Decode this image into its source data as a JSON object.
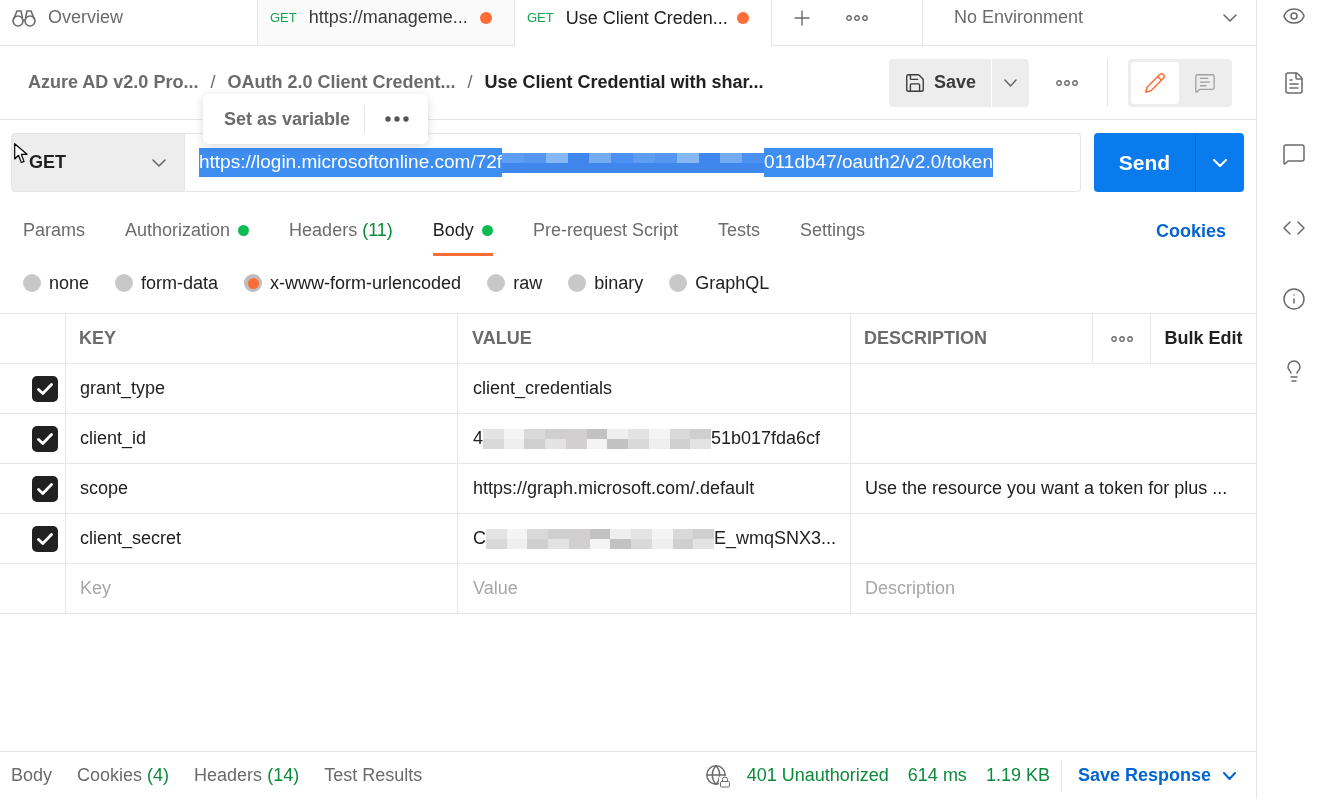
{
  "tab_bar": {
    "overview": "Overview",
    "tabs": [
      {
        "method": "GET",
        "title": "https://manageme...",
        "unsaved": true,
        "selected": false
      },
      {
        "method": "GET",
        "title": "Use Client Creden...",
        "unsaved": true,
        "selected": true
      }
    ],
    "environment": "No Environment"
  },
  "breadcrumb": [
    {
      "kind": "link",
      "label": "Azure AD v2.0 Pro..."
    },
    {
      "kind": "separator",
      "label": "/"
    },
    {
      "kind": "link",
      "label": "OAuth 2.0 Client Credent..."
    },
    {
      "kind": "separator",
      "label": "/"
    },
    {
      "kind": "current",
      "label": "Use Client Credential with shar..."
    }
  ],
  "toolbar": {
    "save": "Save",
    "mode": [
      {
        "kind": "edit",
        "selected": true
      },
      {
        "kind": "comments",
        "selected": false
      }
    ]
  },
  "selection_popup": {
    "action": "Set as variable"
  },
  "request": {
    "method": "GET",
    "url": {
      "start": "https://login.microsoftonline.com/72f",
      "end": "011db47/oauth2/v2.0/token",
      "redacted": true,
      "selected": true
    },
    "send": "Send"
  },
  "request_tabs": [
    {
      "label": "Params",
      "indicator": false,
      "selected": false
    },
    {
      "label": "Authorization",
      "indicator": true,
      "selected": false
    },
    {
      "label": "Headers",
      "count": "(11)",
      "indicator": false,
      "selected": false
    },
    {
      "label": "Body",
      "indicator": true,
      "selected": true
    },
    {
      "label": "Pre-request Script",
      "indicator": false,
      "selected": false
    },
    {
      "label": "Tests",
      "indicator": false,
      "selected": false
    },
    {
      "label": "Settings",
      "indicator": false,
      "selected": false
    }
  ],
  "cookies_link": "Cookies",
  "body_types": [
    {
      "label": "none",
      "selected": false
    },
    {
      "label": "form-data",
      "selected": false
    },
    {
      "label": "x-www-form-urlencoded",
      "selected": true
    },
    {
      "label": "raw",
      "selected": false
    },
    {
      "label": "binary",
      "selected": false
    },
    {
      "label": "GraphQL",
      "selected": false
    }
  ],
  "params_table": {
    "columns": [
      "KEY",
      "VALUE",
      "DESCRIPTION"
    ],
    "bulk_edit": "Bulk Edit",
    "rows": [
      {
        "checked": true,
        "key": "grant_type",
        "value": "client_credentials",
        "redacted": false
      },
      {
        "checked": true,
        "key": "client_id",
        "value_start": "4",
        "value_end": "51b017fda6cf",
        "redacted": true
      },
      {
        "checked": true,
        "key": "scope",
        "value": "https://graph.microsoft.com/.default",
        "redacted": false,
        "description": "Use the resource you want a token for plus ..."
      },
      {
        "checked": true,
        "key": "client_secret",
        "value_start": "C",
        "value_end": "E_wmqSNX3...",
        "redacted": true
      }
    ],
    "new_row": {
      "key": {
        "placeholder": "Key"
      },
      "value": {
        "placeholder": "Value"
      },
      "description": {
        "placeholder": "Description"
      }
    }
  },
  "response": {
    "tabs": [
      {
        "label": "Body"
      },
      {
        "label": "Cookies",
        "count": "(4)"
      },
      {
        "label": "Headers",
        "count": "(14)"
      },
      {
        "label": "Test Results"
      }
    ],
    "status": "401 Unauthorized",
    "time": "614 ms",
    "size": "1.19 KB",
    "save_response": "Save Response"
  }
}
